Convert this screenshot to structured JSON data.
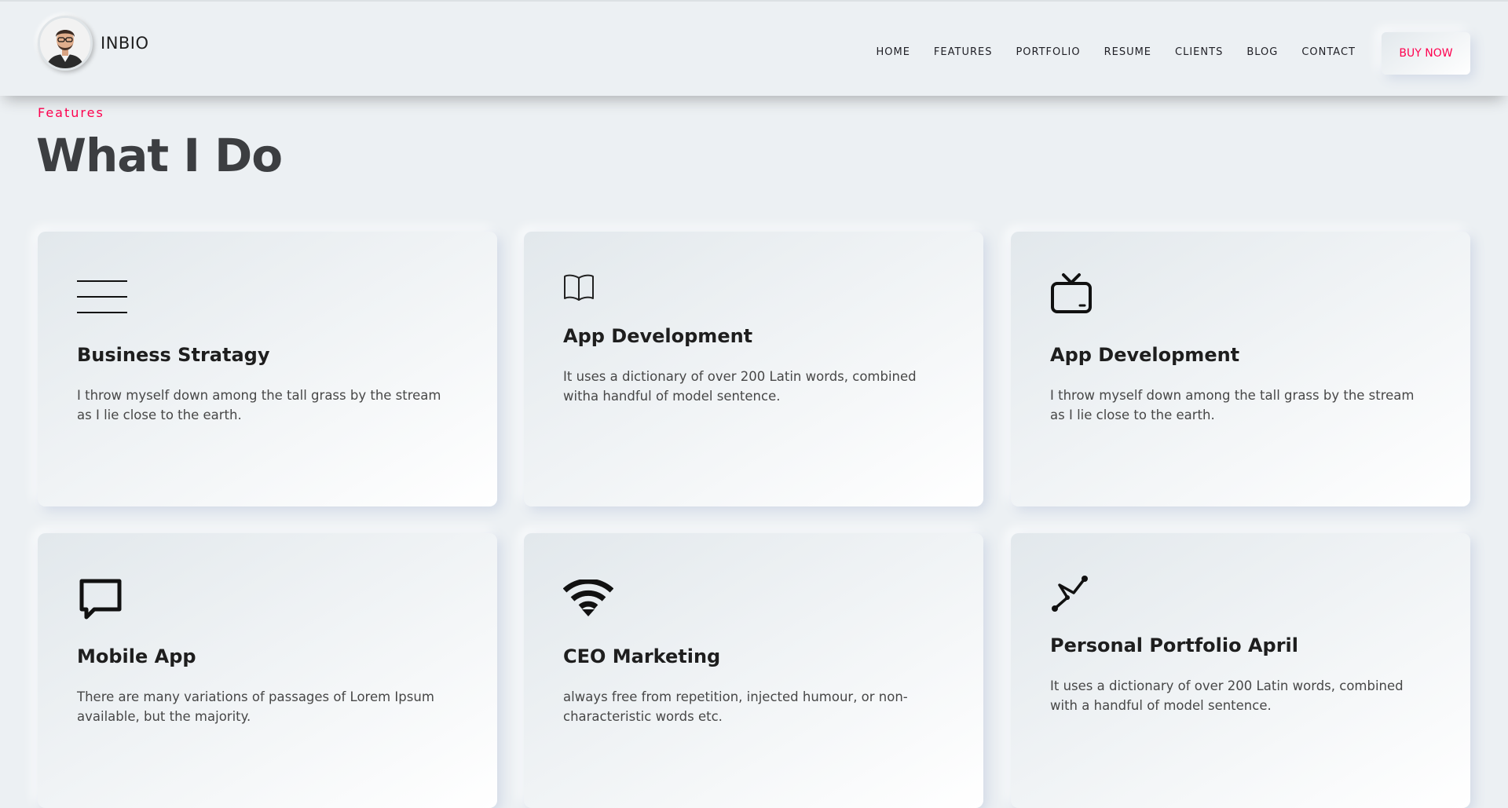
{
  "header": {
    "brand": "INBIO",
    "nav": [
      "HOME",
      "FEATURES",
      "PORTFOLIO",
      "RESUME",
      "CLIENTS",
      "BLOG",
      "CONTACT"
    ],
    "cta": "BUY NOW"
  },
  "section": {
    "subtitle": "Features",
    "title": "What I Do"
  },
  "cards": [
    {
      "icon": "menu-lines-icon",
      "title": "Business Stratagy",
      "desc": "I throw myself down among the tall grass by the stream as I lie close to the earth."
    },
    {
      "icon": "book-icon",
      "title": "App Development",
      "desc": "It uses a dictionary of over 200 Latin words, combined witha handful of model sentence."
    },
    {
      "icon": "tv-icon",
      "title": "App Development",
      "desc": "I throw myself down among the tall grass by the stream as I lie close to the earth."
    },
    {
      "icon": "chat-bubble-icon",
      "title": "Mobile App",
      "desc": "There are many variations of passages of Lorem Ipsum available, but the majority."
    },
    {
      "icon": "wifi-icon",
      "title": "CEO Marketing",
      "desc": "always free from repetition, injected humour, or non-characteristic words etc."
    },
    {
      "icon": "graph-nodes-icon",
      "title": "Personal Portfolio April",
      "desc": "It uses a dictionary of over 200 Latin words, combined with a handful of model sentence."
    }
  ],
  "colors": {
    "accent": "#ff014f",
    "background": "#ecf0f3",
    "heading": "#3c3e41"
  }
}
